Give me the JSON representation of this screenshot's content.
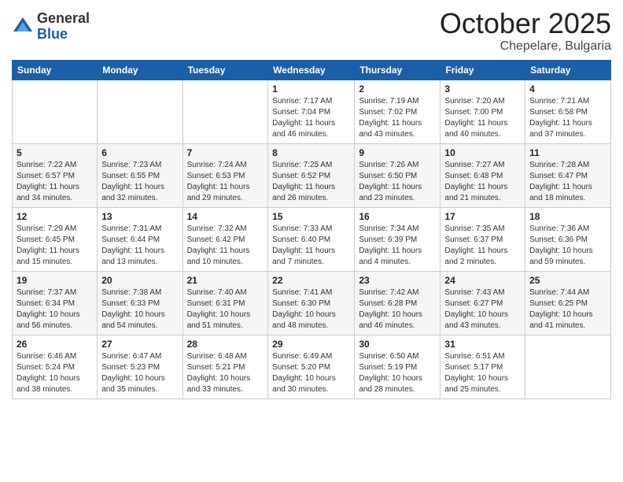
{
  "logo": {
    "general": "General",
    "blue": "Blue"
  },
  "header": {
    "month": "October 2025",
    "location": "Chepelare, Bulgaria"
  },
  "weekdays": [
    "Sunday",
    "Monday",
    "Tuesday",
    "Wednesday",
    "Thursday",
    "Friday",
    "Saturday"
  ],
  "weeks": [
    [
      {
        "day": "",
        "info": ""
      },
      {
        "day": "",
        "info": ""
      },
      {
        "day": "",
        "info": ""
      },
      {
        "day": "1",
        "info": "Sunrise: 7:17 AM\nSunset: 7:04 PM\nDaylight: 11 hours and 46 minutes."
      },
      {
        "day": "2",
        "info": "Sunrise: 7:19 AM\nSunset: 7:02 PM\nDaylight: 11 hours and 43 minutes."
      },
      {
        "day": "3",
        "info": "Sunrise: 7:20 AM\nSunset: 7:00 PM\nDaylight: 11 hours and 40 minutes."
      },
      {
        "day": "4",
        "info": "Sunrise: 7:21 AM\nSunset: 6:58 PM\nDaylight: 11 hours and 37 minutes."
      }
    ],
    [
      {
        "day": "5",
        "info": "Sunrise: 7:22 AM\nSunset: 6:57 PM\nDaylight: 11 hours and 34 minutes."
      },
      {
        "day": "6",
        "info": "Sunrise: 7:23 AM\nSunset: 6:55 PM\nDaylight: 11 hours and 32 minutes."
      },
      {
        "day": "7",
        "info": "Sunrise: 7:24 AM\nSunset: 6:53 PM\nDaylight: 11 hours and 29 minutes."
      },
      {
        "day": "8",
        "info": "Sunrise: 7:25 AM\nSunset: 6:52 PM\nDaylight: 11 hours and 26 minutes."
      },
      {
        "day": "9",
        "info": "Sunrise: 7:26 AM\nSunset: 6:50 PM\nDaylight: 11 hours and 23 minutes."
      },
      {
        "day": "10",
        "info": "Sunrise: 7:27 AM\nSunset: 6:48 PM\nDaylight: 11 hours and 21 minutes."
      },
      {
        "day": "11",
        "info": "Sunrise: 7:28 AM\nSunset: 6:47 PM\nDaylight: 11 hours and 18 minutes."
      }
    ],
    [
      {
        "day": "12",
        "info": "Sunrise: 7:29 AM\nSunset: 6:45 PM\nDaylight: 11 hours and 15 minutes."
      },
      {
        "day": "13",
        "info": "Sunrise: 7:31 AM\nSunset: 6:44 PM\nDaylight: 11 hours and 13 minutes."
      },
      {
        "day": "14",
        "info": "Sunrise: 7:32 AM\nSunset: 6:42 PM\nDaylight: 11 hours and 10 minutes."
      },
      {
        "day": "15",
        "info": "Sunrise: 7:33 AM\nSunset: 6:40 PM\nDaylight: 11 hours and 7 minutes."
      },
      {
        "day": "16",
        "info": "Sunrise: 7:34 AM\nSunset: 6:39 PM\nDaylight: 11 hours and 4 minutes."
      },
      {
        "day": "17",
        "info": "Sunrise: 7:35 AM\nSunset: 6:37 PM\nDaylight: 11 hours and 2 minutes."
      },
      {
        "day": "18",
        "info": "Sunrise: 7:36 AM\nSunset: 6:36 PM\nDaylight: 10 hours and 59 minutes."
      }
    ],
    [
      {
        "day": "19",
        "info": "Sunrise: 7:37 AM\nSunset: 6:34 PM\nDaylight: 10 hours and 56 minutes."
      },
      {
        "day": "20",
        "info": "Sunrise: 7:38 AM\nSunset: 6:33 PM\nDaylight: 10 hours and 54 minutes."
      },
      {
        "day": "21",
        "info": "Sunrise: 7:40 AM\nSunset: 6:31 PM\nDaylight: 10 hours and 51 minutes."
      },
      {
        "day": "22",
        "info": "Sunrise: 7:41 AM\nSunset: 6:30 PM\nDaylight: 10 hours and 48 minutes."
      },
      {
        "day": "23",
        "info": "Sunrise: 7:42 AM\nSunset: 6:28 PM\nDaylight: 10 hours and 46 minutes."
      },
      {
        "day": "24",
        "info": "Sunrise: 7:43 AM\nSunset: 6:27 PM\nDaylight: 10 hours and 43 minutes."
      },
      {
        "day": "25",
        "info": "Sunrise: 7:44 AM\nSunset: 6:25 PM\nDaylight: 10 hours and 41 minutes."
      }
    ],
    [
      {
        "day": "26",
        "info": "Sunrise: 6:46 AM\nSunset: 5:24 PM\nDaylight: 10 hours and 38 minutes."
      },
      {
        "day": "27",
        "info": "Sunrise: 6:47 AM\nSunset: 5:23 PM\nDaylight: 10 hours and 35 minutes."
      },
      {
        "day": "28",
        "info": "Sunrise: 6:48 AM\nSunset: 5:21 PM\nDaylight: 10 hours and 33 minutes."
      },
      {
        "day": "29",
        "info": "Sunrise: 6:49 AM\nSunset: 5:20 PM\nDaylight: 10 hours and 30 minutes."
      },
      {
        "day": "30",
        "info": "Sunrise: 6:50 AM\nSunset: 5:19 PM\nDaylight: 10 hours and 28 minutes."
      },
      {
        "day": "31",
        "info": "Sunrise: 6:51 AM\nSunset: 5:17 PM\nDaylight: 10 hours and 25 minutes."
      },
      {
        "day": "",
        "info": ""
      }
    ]
  ]
}
